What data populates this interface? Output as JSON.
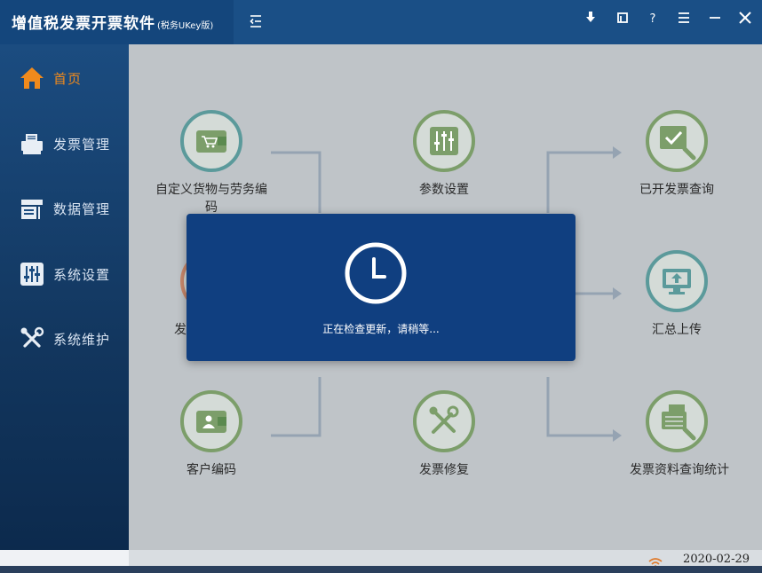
{
  "window": {
    "title": "增值税发票开票软件",
    "subtitle": "(税务UKey版)",
    "controls": [
      "download-icon",
      "restore-icon",
      "help-icon",
      "menu-icon",
      "minimize-icon",
      "close-icon"
    ]
  },
  "sidebar": {
    "items": [
      {
        "label": "首页",
        "icon": "home-icon",
        "active": true
      },
      {
        "label": "发票管理",
        "icon": "printer-icon",
        "active": false
      },
      {
        "label": "数据管理",
        "icon": "data-icon",
        "active": false
      },
      {
        "label": "系统设置",
        "icon": "sliders-icon",
        "active": false
      },
      {
        "label": "系统维护",
        "icon": "tools-icon",
        "active": false
      }
    ]
  },
  "main": {
    "functions": [
      {
        "label_line1": "自定义货物与劳务编",
        "label_line2": "码",
        "icon": "wallet-cart-icon"
      },
      {
        "label": "参数设置",
        "icon": "sliders-icon"
      },
      {
        "label": "已开发票查询",
        "icon": "search-check-icon"
      },
      {
        "label": "发",
        "icon": "invoice-icon"
      },
      {
        "label": "汇总上传",
        "icon": "upload-monitor-icon"
      },
      {
        "label": "客户编码",
        "icon": "customer-card-icon"
      },
      {
        "label": "发票修复",
        "icon": "repair-tools-icon"
      },
      {
        "label": "发票资料查询统计",
        "icon": "stats-search-icon"
      }
    ]
  },
  "modal": {
    "message": "正在检查更新，请稍等...",
    "icon": "clock-icon"
  },
  "footer": {
    "date": "2020-02-29",
    "icon": "wifi-icon"
  },
  "colors": {
    "titlebar": "#1a4f86",
    "accent": "#f08a1c",
    "modal": "#103f80",
    "green_ring": "#7c9e6a",
    "teal_ring": "#5b9a9b"
  }
}
